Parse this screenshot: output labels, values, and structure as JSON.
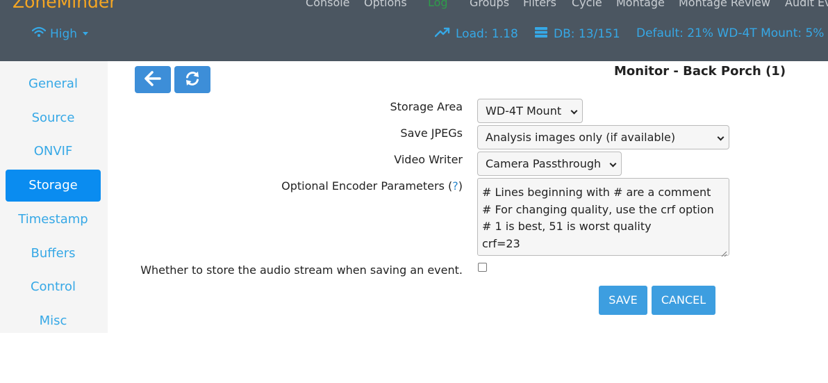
{
  "brand": "ZoneMinder",
  "topmenu": {
    "items": [
      {
        "label": "Console"
      },
      {
        "label": "Options"
      },
      {
        "label": "Log"
      },
      {
        "label": "Groups"
      },
      {
        "label": "Filters"
      },
      {
        "label": "Cycle"
      },
      {
        "label": "Montage"
      },
      {
        "label": "Montage Review"
      },
      {
        "label": "Audit Ev"
      }
    ],
    "active_label": "Log",
    "active_color": "#2e9d4a"
  },
  "bandwidth": {
    "label": "High",
    "icon": "wifi-icon"
  },
  "status": {
    "load": "Load: 1.18",
    "db": "DB: 13/151",
    "storage": "Default: 21% WD-4T Mount: 5%",
    "load_icon": "trend-up-icon",
    "db_icon": "database-icon"
  },
  "sidebar": {
    "items": [
      {
        "label": "General"
      },
      {
        "label": "Source"
      },
      {
        "label": "ONVIF"
      },
      {
        "label": "Storage"
      },
      {
        "label": "Timestamp"
      },
      {
        "label": "Buffers"
      },
      {
        "label": "Control"
      },
      {
        "label": "Misc"
      }
    ],
    "active": "Storage"
  },
  "toolbar": {
    "back_icon": "arrow-left-icon",
    "refresh_icon": "refresh-icon"
  },
  "page_title": "Monitor - Back Porch (1)",
  "form": {
    "storage_area": {
      "label": "Storage Area",
      "value": "WD-4T Mount"
    },
    "save_jpegs": {
      "label": "Save JPEGs",
      "value": "Analysis images only (if available)"
    },
    "video_writer": {
      "label": "Video Writer",
      "value": "Camera Passthrough"
    },
    "encoder_params": {
      "label": "Optional Encoder Parameters (",
      "help": "?",
      "label_end": ")",
      "value": "# Lines beginning with # are a comment\n# For changing quality, use the crf option\n# 1 is best, 51 is worst quality\ncrf=23"
    },
    "record_audio": {
      "label": "Whether to store the audio stream when saving an event.",
      "checked": false
    }
  },
  "buttons": {
    "save": "SAVE",
    "cancel": "CANCEL"
  },
  "colors": {
    "navbar_bg": "#4b5661",
    "brand": "#f5a623",
    "accent": "#36a8e6",
    "active_tab": "#0a8cf0",
    "button": "#3d9ee0"
  }
}
